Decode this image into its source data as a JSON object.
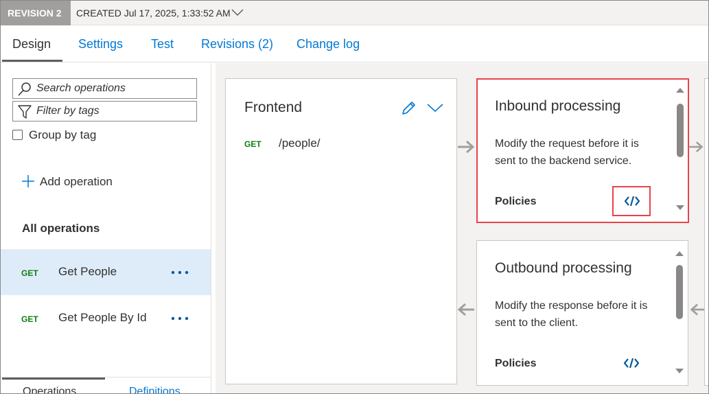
{
  "revision_bar": {
    "badge": "REVISION 2",
    "created": "CREATED Jul 17, 2025, 1:33:52 AM"
  },
  "tabs": [
    {
      "label": "Design",
      "active": true
    },
    {
      "label": "Settings",
      "active": false
    },
    {
      "label": "Test",
      "active": false
    },
    {
      "label": "Revisions (2)",
      "active": false
    },
    {
      "label": "Change log",
      "active": false
    }
  ],
  "left_panel": {
    "search_placeholder": "Search operations",
    "filter_placeholder": "Filter by tags",
    "group_by_tag_label": "Group by tag",
    "group_by_tag_checked": false,
    "add_operation_label": "Add operation",
    "all_operations_label": "All operations",
    "operations": [
      {
        "method": "GET",
        "name": "Get People",
        "selected": true
      },
      {
        "method": "GET",
        "name": "Get People By Id",
        "selected": false
      }
    ],
    "bottom_tabs": [
      "Operations",
      "Definitions"
    ]
  },
  "frontend": {
    "title": "Frontend",
    "method": "GET",
    "path": "/people/"
  },
  "inbound": {
    "title": "Inbound processing",
    "description": "Modify the request before it is sent to the backend service.",
    "policies_label": "Policies"
  },
  "outbound": {
    "title": "Outbound processing",
    "description": "Modify the response before it is sent to the client.",
    "policies_label": "Policies"
  },
  "colors": {
    "accent": "#0078d4",
    "get_method": "#107c10",
    "highlight_border": "#e8434b",
    "selected_row": "#deecf9",
    "canvas_bg": "#f3f2f1"
  },
  "icons": [
    "chevron-down-icon",
    "search-icon",
    "filter-icon",
    "plus-icon",
    "more-icon",
    "edit-pencil-icon",
    "code-editor-icon",
    "arrow-right-icon",
    "arrow-left-icon",
    "scroll-up-icon",
    "scroll-down-icon"
  ]
}
